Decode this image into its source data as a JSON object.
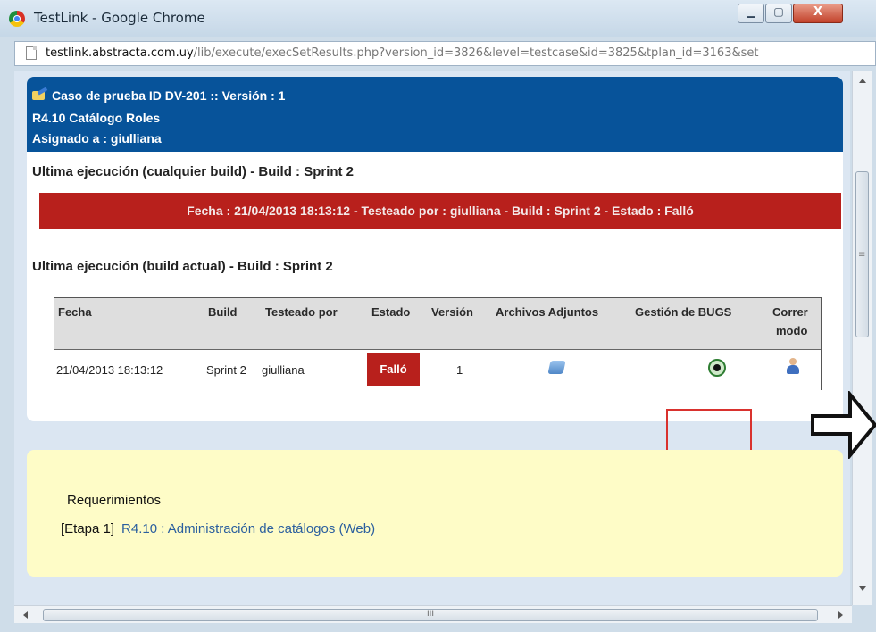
{
  "window": {
    "title": "TestLink - Google Chrome",
    "minimize_label": "▁",
    "maximize_label": "▢",
    "close_label": "X"
  },
  "address": {
    "host": "testlink.abstracta.com.uy",
    "path": "/lib/execute/execSetResults.php?version_id=3826&level=testcase&id=3825&tplan_id=3163&set"
  },
  "testcase": {
    "title_line": "Caso de prueba ID DV-201 :: Versión : 1",
    "name_line": "R4.10 Catálogo Roles",
    "assigned_line": "Asignado a : giulliana"
  },
  "last_execution": {
    "any_build_heading": "Ultima ejecución (cualquier build) - Build : Sprint 2",
    "banner": "Fecha : 21/04/2013 18:13:12 - Testeado por : giulliana - Build : Sprint 2 - Estado : Falló",
    "current_build_heading": "Ultima ejecución (build actual) - Build : Sprint 2"
  },
  "table": {
    "headers": [
      "Fecha",
      "Build",
      "Testeado por",
      "Estado",
      "Versión",
      "Archivos Adjuntos",
      "Gestión de BUGS",
      "Correr",
      "modo"
    ],
    "row": {
      "fecha": "21/04/2013 18:13:12",
      "build": "Sprint 2",
      "testeado_por": "giulliana",
      "estado": "Falló",
      "version": "1"
    },
    "icons": {
      "attachments": "attachment-icon",
      "bugs": "bug-icon",
      "run_mode": "user-icon"
    }
  },
  "requirements": {
    "title": "Requerimientos",
    "step": "[Etapa 1]",
    "link": "R4.10 : Administración de catálogos (Web)"
  },
  "scrollbar": {
    "grip": "≡",
    "h_grip": "III"
  },
  "colors": {
    "header_blue": "#07539a",
    "fail_red": "#b8201c",
    "highlight_red": "#d9322e",
    "requirements_yellow": "#fefcc7",
    "link_blue": "#2b5f9e"
  }
}
